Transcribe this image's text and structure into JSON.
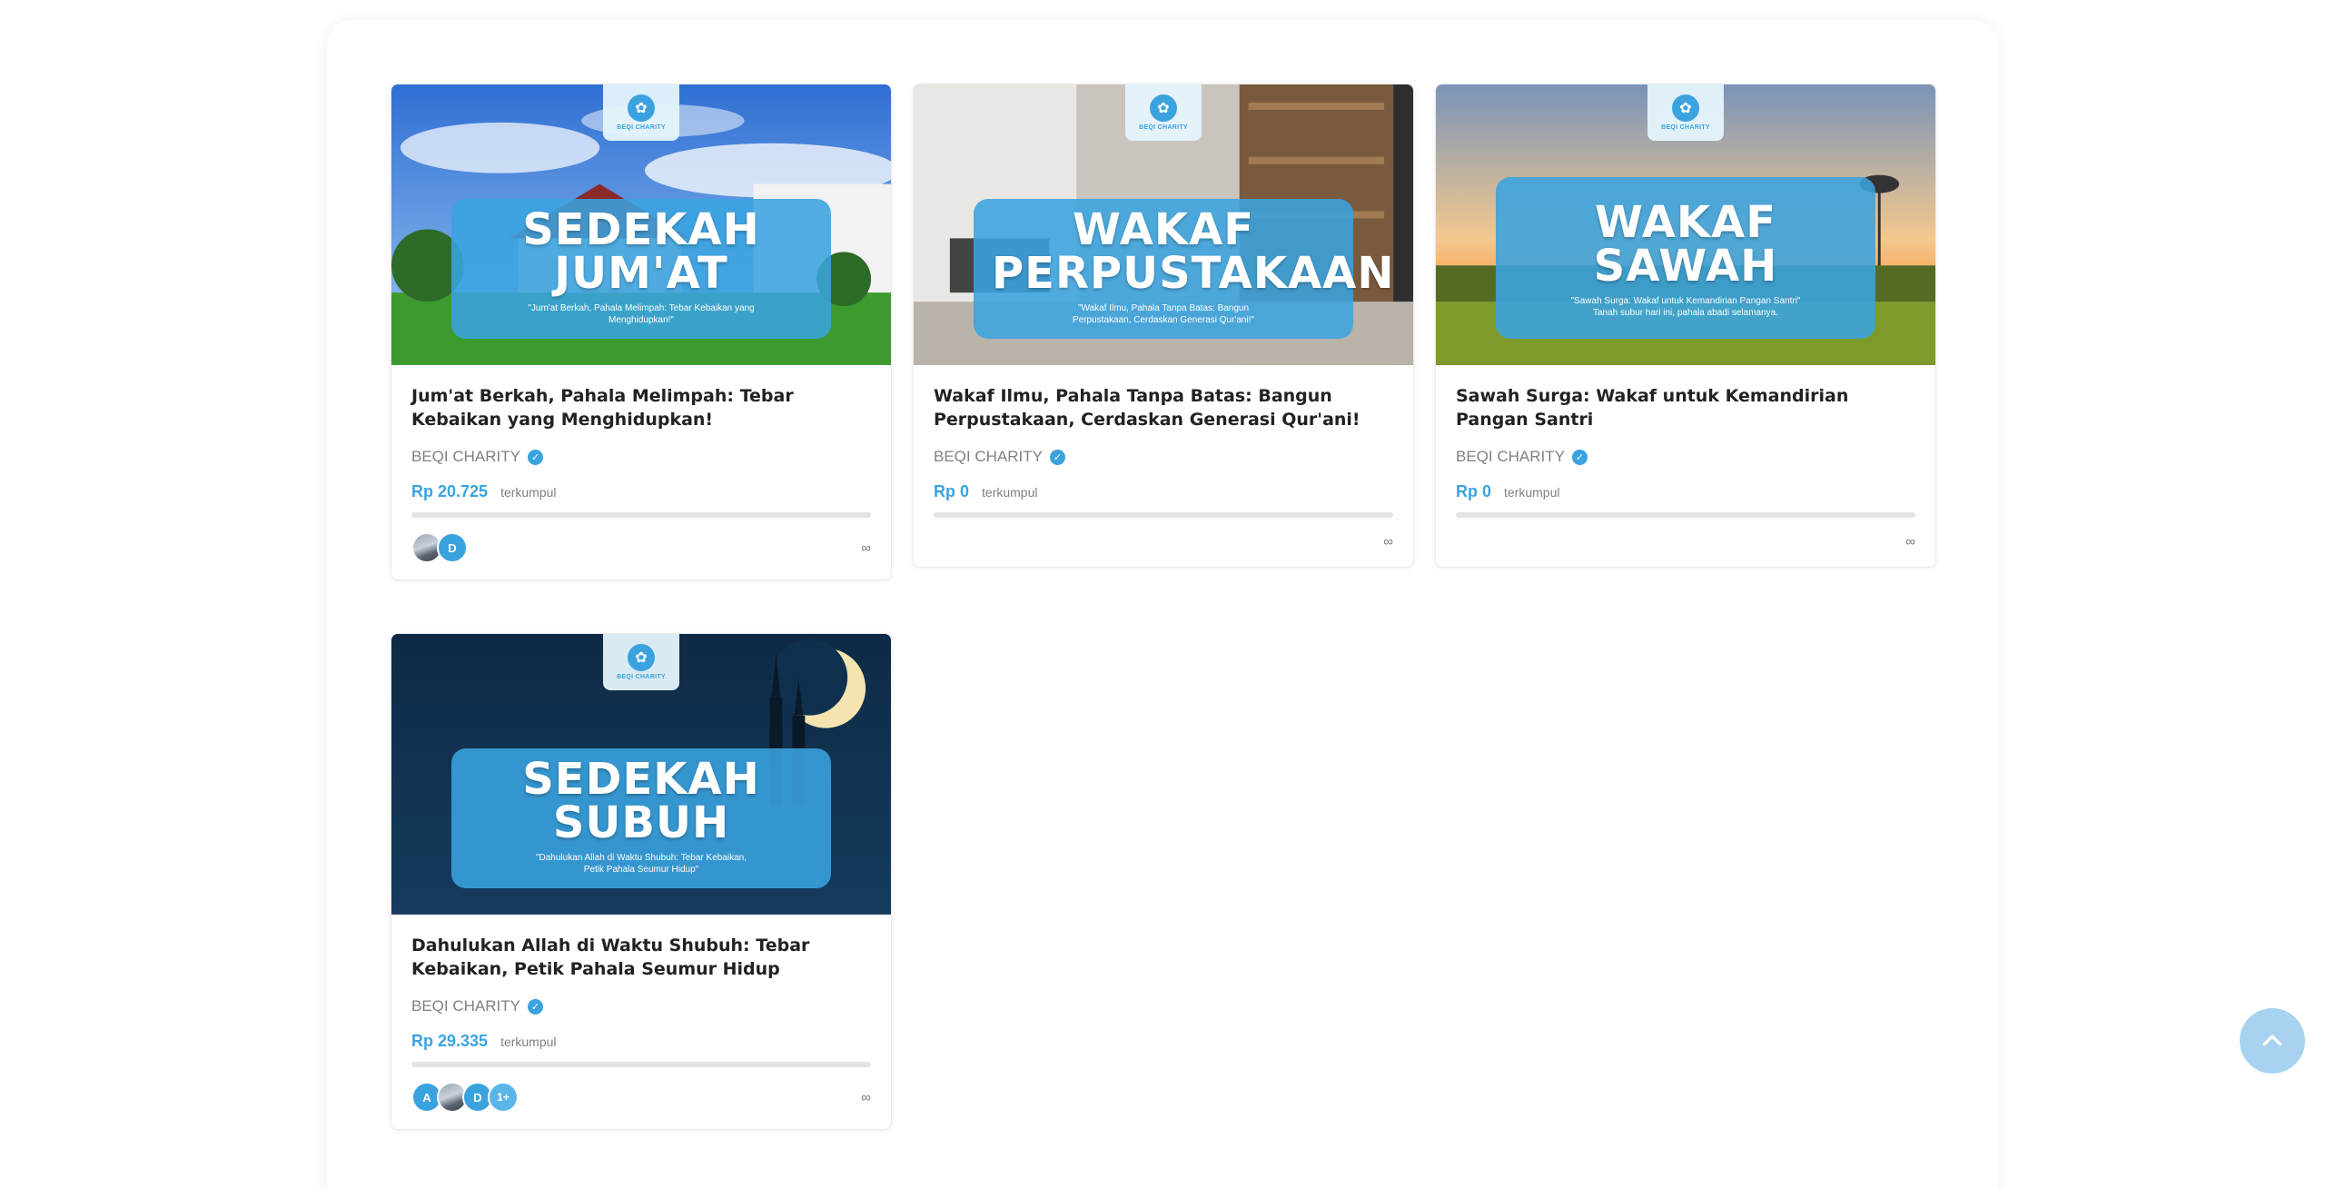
{
  "brand": {
    "logo_text": "BEQI CHARITY",
    "accent": "#3aa3df"
  },
  "campaigns": [
    {
      "banner_title": "SEDEKAH\nJUM'AT",
      "banner_subtitle": "\"Jum'at Berkah, Pahala Melimpah: Tebar Kebaikan yang\nMenghidupkan!\"",
      "title": "Jum'at Berkah, Pahala Melimpah: Tebar Kebaikan yang Menghidupkan!",
      "organizer": "BEQI CHARITY",
      "amount": "Rp 20.725",
      "collected_label": "terkumpul",
      "progress": 0,
      "donors": [
        "photo",
        "D"
      ],
      "duration": "∞"
    },
    {
      "banner_title": "WAKAF\nPERPUSTAKAAN",
      "banner_subtitle": "\"Wakaf Ilmu, Pahala Tanpa Batas: Bangun\nPerpustakaan, Cerdaskan Generasi Qur'ani!\"",
      "title": "Wakaf Ilmu, Pahala Tanpa Batas: Bangun Perpustakaan, Cerdaskan Generasi Qur'ani!",
      "organizer": "BEQI CHARITY",
      "amount": "Rp 0",
      "collected_label": "terkumpul",
      "progress": 0,
      "donors": [],
      "duration": "∞"
    },
    {
      "banner_title": "WAKAF SAWAH",
      "banner_subtitle": "\"Sawah Surga: Wakaf untuk Kemandirian Pangan Santri\"\nTanah subur hari ini, pahala abadi selamanya.",
      "title": "Sawah Surga: Wakaf untuk Kemandirian Pangan Santri",
      "organizer": "BEQI CHARITY",
      "amount": "Rp 0",
      "collected_label": "terkumpul",
      "progress": 0,
      "donors": [],
      "duration": "∞"
    },
    {
      "banner_title": "SEDEKAH\nSUBUH",
      "banner_subtitle": "\"Dahulukan Allah di Waktu Shubuh: Tebar Kebaikan,\nPetik Pahala Seumur Hidup\"",
      "title": "Dahulukan Allah di Waktu Shubuh: Tebar Kebaikan, Petik Pahala Seumur Hidup",
      "organizer": "BEQI CHARITY",
      "amount": "Rp 29.335",
      "collected_label": "terkumpul",
      "progress": 0,
      "donors": [
        "A",
        "photo",
        "D",
        "1+"
      ],
      "duration": "∞"
    }
  ],
  "scroll_top_icon": "chevron-up-icon"
}
